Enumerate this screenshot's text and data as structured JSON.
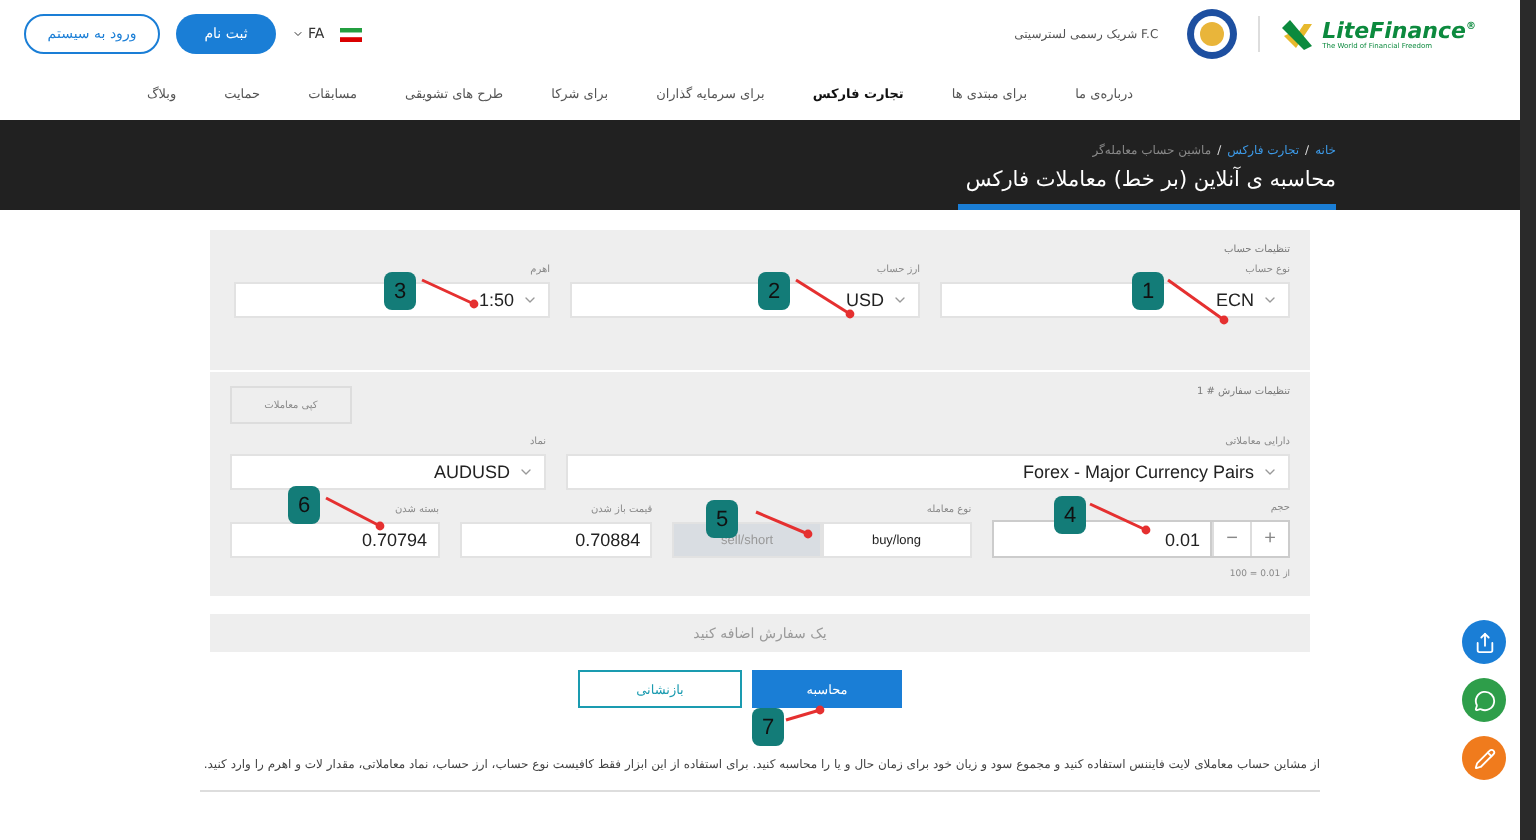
{
  "header": {
    "brand": "LiteFinance",
    "brand_mark": "®",
    "tagline": "The World of Financial Freedom",
    "partner": "شریک رسمی لسترسیتی F.C",
    "language": "FA",
    "register": "ثبت نام",
    "login": "ورود به سیستم"
  },
  "nav": [
    {
      "label": "درباره‌ی ما",
      "selected": false
    },
    {
      "label": "برای مبتدی ها",
      "selected": false
    },
    {
      "label": "تجارت فارکس",
      "selected": true
    },
    {
      "label": "برای سرمایه گذاران",
      "selected": false
    },
    {
      "label": "برای شرکا",
      "selected": false
    },
    {
      "label": "طرح های تشویقی",
      "selected": false
    },
    {
      "label": "مسابقات",
      "selected": false
    },
    {
      "label": "حمایت",
      "selected": false
    },
    {
      "label": "وبلاگ",
      "selected": false
    }
  ],
  "breadcrumb": [
    {
      "label": "خانه",
      "kind": "link"
    },
    {
      "label": "/",
      "kind": "separator"
    },
    {
      "label": "تجارت فارکس",
      "kind": "link"
    },
    {
      "label": "/",
      "kind": "separator"
    },
    {
      "label": "ماشین حساب معامله‌گر",
      "kind": "current"
    }
  ],
  "title": "محاسبه ی آنلاین (بر خط) معاملات فارکس",
  "account_settings": {
    "heading": "تنظیمات حساب",
    "fields": [
      {
        "label": "نوع حساب",
        "value": "ECN"
      },
      {
        "label": "ارز حساب",
        "value": "USD"
      },
      {
        "label": "اهرم",
        "value": "1:50"
      }
    ]
  },
  "order": {
    "heading": "تنظیمات سفارش # 1",
    "copy_button": "کپی معاملات",
    "asset": {
      "label": "دارایی معاملاتی",
      "value": "Forex - Major Currency Pairs"
    },
    "symbol": {
      "label": "نماد",
      "value": "AUDUSD"
    },
    "volume": {
      "label": "حجم",
      "value": "0.01",
      "minus": "−",
      "plus": "+",
      "hint": "از 0.01 = 100"
    },
    "trade_type": {
      "label": "نوع معامله",
      "options": [
        {
          "label": "buy/long",
          "selected": true
        },
        {
          "label": "sell/short",
          "selected": false
        }
      ]
    },
    "open_price": {
      "label": "قیمت باز شدن",
      "value": "0.70884"
    },
    "close_price": {
      "label": "بسته شدن",
      "value": "0.70794"
    }
  },
  "add_order": "یک سفارش اضافه کنید",
  "buttons": {
    "calculate": "محاسبه",
    "reset": "بازنشانی"
  },
  "description": "از مشاین حساب معاملای لایت فایننس استفاده کنید و مجموع سود و زیان خود برای زمان حال و یا را محاسبه کنید. برای استفاده از این ابزار فقط کافیست نوع حساب، ارز حساب، نماد معاملاتی، مقدار لات و اهرم را وارد کنید.",
  "annotations": [
    {
      "label": "1"
    },
    {
      "label": "2"
    },
    {
      "label": "3"
    },
    {
      "label": "4"
    },
    {
      "label": "5"
    },
    {
      "label": "6"
    },
    {
      "label": "7"
    }
  ],
  "floating_buttons": [
    {
      "kind": "share"
    },
    {
      "kind": "chat"
    },
    {
      "kind": "edit"
    }
  ]
}
